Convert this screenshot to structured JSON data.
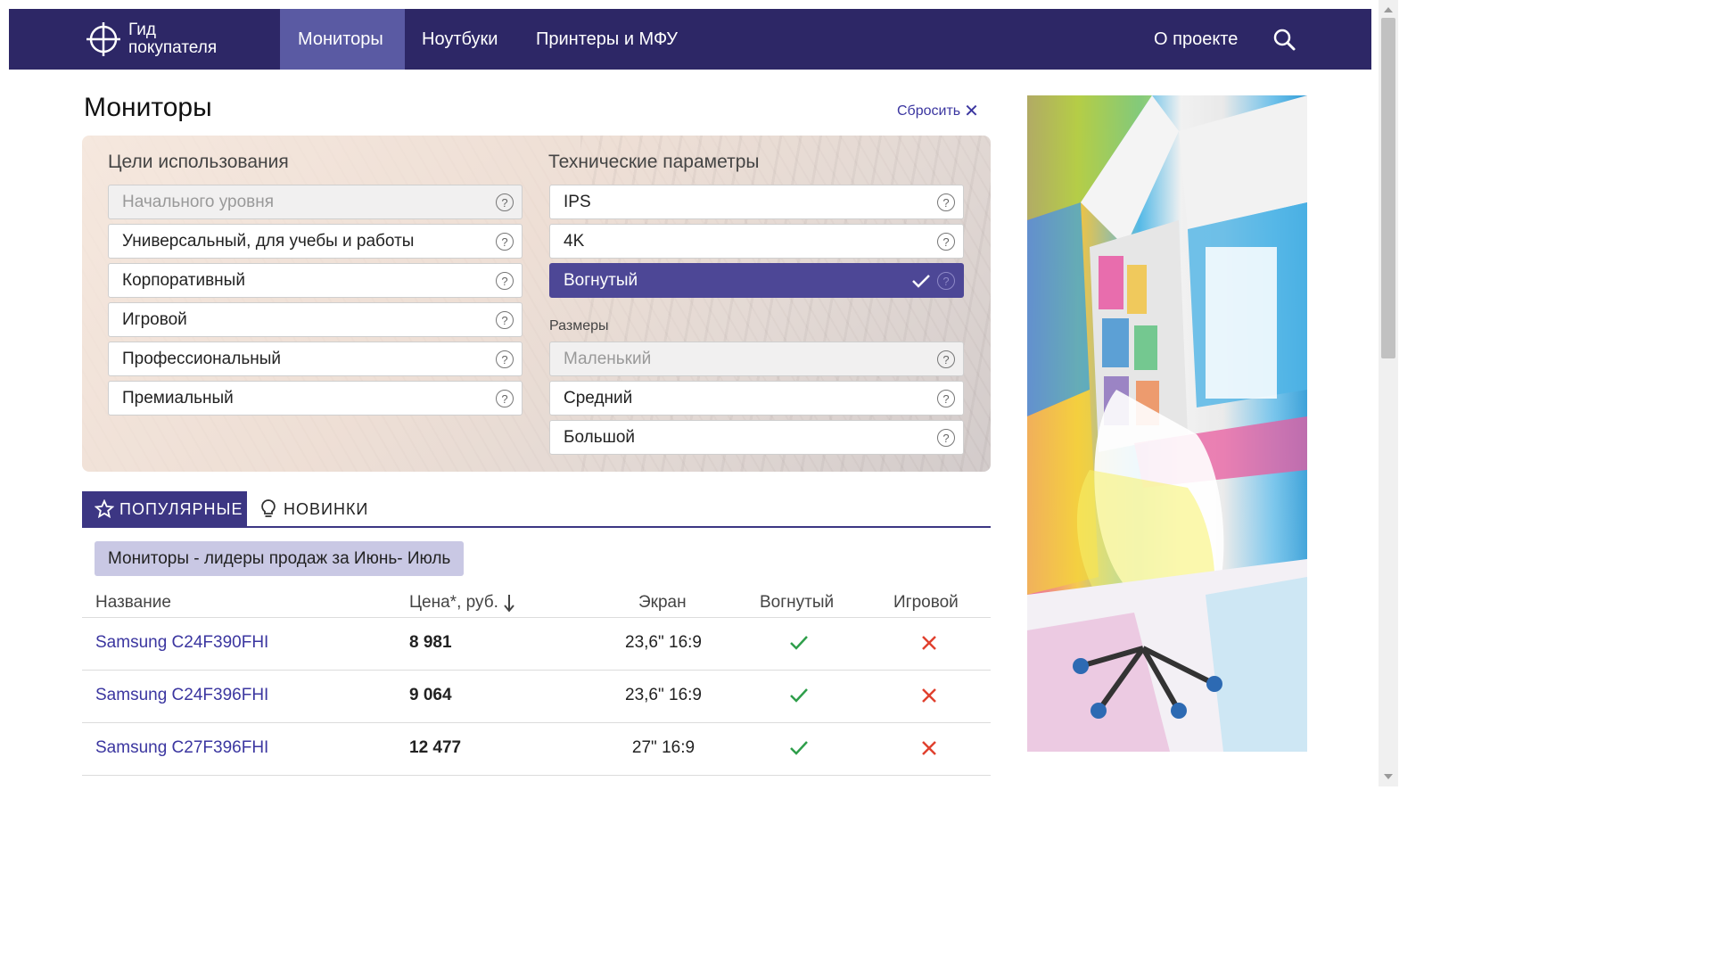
{
  "header": {
    "logo_line1": "Гид",
    "logo_line2": "покупателя",
    "nav": [
      {
        "label": "Мониторы",
        "active": true
      },
      {
        "label": "Ноутбуки",
        "active": false
      },
      {
        "label": "Принтеры и МФУ",
        "active": false
      }
    ],
    "about": "О проекте",
    "search_icon": "search-icon"
  },
  "page": {
    "title": "Мониторы",
    "reset_label": "Сбросить"
  },
  "filters": {
    "usage_heading": "Цели использования",
    "usage": [
      {
        "label": "Начального уровня",
        "state": "disabled"
      },
      {
        "label": "Универсальный, для учебы и работы",
        "state": "normal"
      },
      {
        "label": "Корпоративный",
        "state": "normal"
      },
      {
        "label": "Игровой",
        "state": "normal"
      },
      {
        "label": "Профессиональный",
        "state": "normal"
      },
      {
        "label": "Премиальный",
        "state": "normal"
      }
    ],
    "tech_heading": "Технические параметры",
    "tech": [
      {
        "label": "IPS",
        "state": "normal"
      },
      {
        "label": "4K",
        "state": "normal"
      },
      {
        "label": "Вогнутый",
        "state": "selected"
      }
    ],
    "sizes_heading": "Размеры",
    "sizes": [
      {
        "label": "Маленький",
        "state": "disabled"
      },
      {
        "label": "Средний",
        "state": "normal"
      },
      {
        "label": "Большой",
        "state": "normal"
      }
    ],
    "help_glyph": "?"
  },
  "tabs": {
    "popular": "ПОПУЛЯРНЫЕ",
    "new": "НОВИНКИ"
  },
  "period_badge": "Мониторы - лидеры продаж за Июнь- Июль",
  "table": {
    "headers": {
      "name": "Название",
      "price": "Цена*, руб.",
      "screen": "Экран",
      "curved": "Вогнутый",
      "gaming": "Игровой"
    },
    "rows": [
      {
        "name": "Samsung C24F390FHI",
        "price": "8 981",
        "screen": "23,6\" 16:9",
        "curved": true,
        "gaming": false
      },
      {
        "name": "Samsung C24F396FHI",
        "price": "9 064",
        "screen": "23,6\" 16:9",
        "curved": true,
        "gaming": false
      },
      {
        "name": "Samsung C27F396FHI",
        "price": "12 477",
        "screen": "27\" 16:9",
        "curved": true,
        "gaming": false
      }
    ]
  },
  "colors": {
    "header_bg": "#2d2766",
    "nav_active": "#5a5aa3",
    "accent": "#3c3683",
    "selected_option": "#4d4796",
    "link": "#3b36a0",
    "check_green": "#2e9e4a",
    "cross_red": "#e0402e"
  }
}
